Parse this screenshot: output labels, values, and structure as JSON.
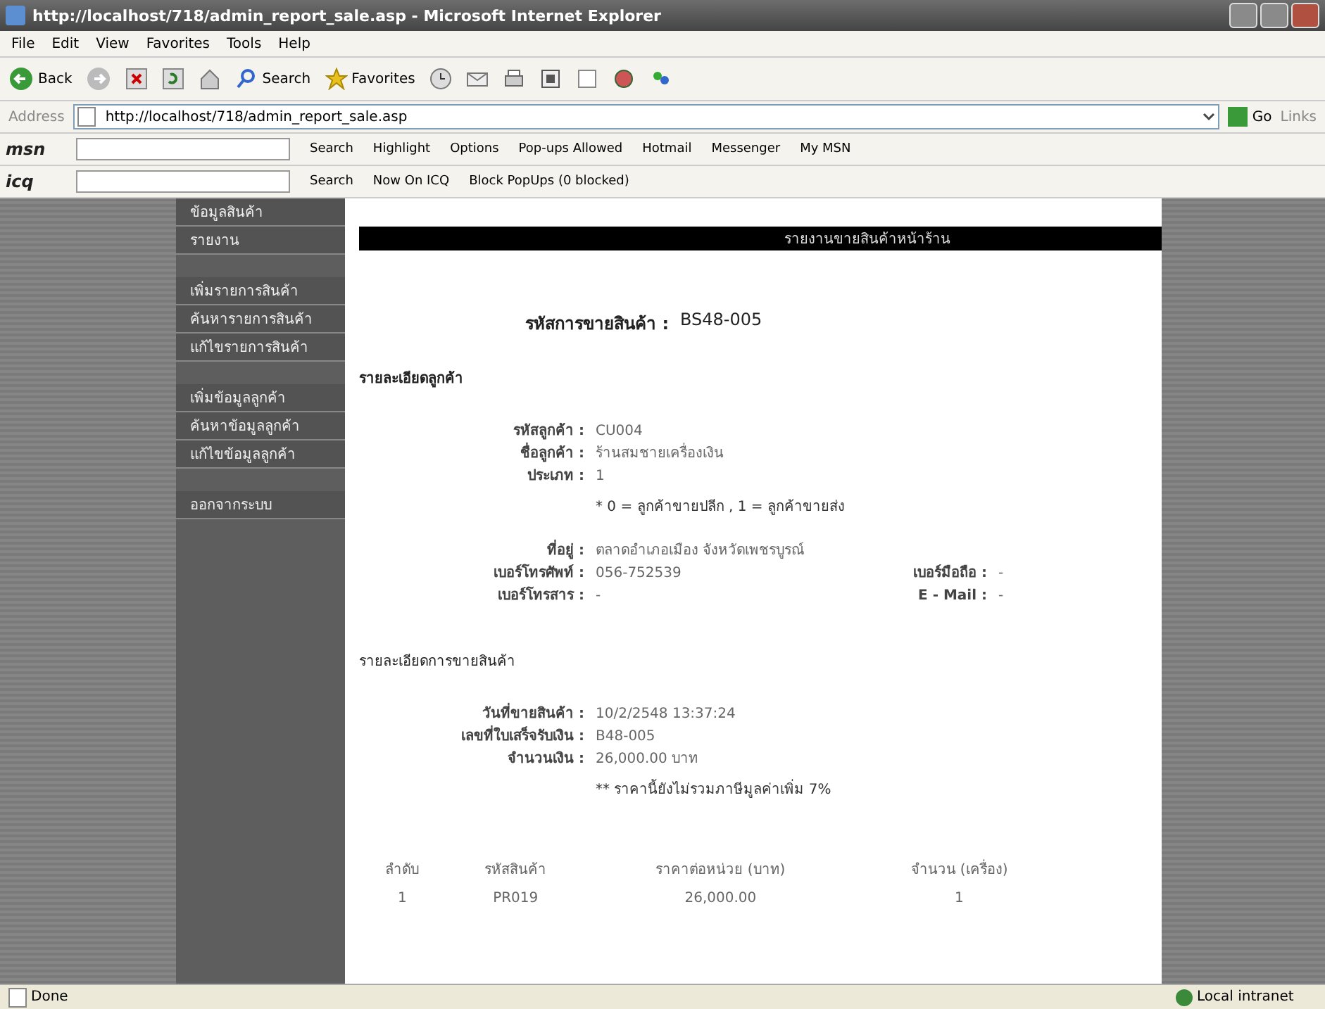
{
  "window": {
    "title": "http://localhost/718/admin_report_sale.asp - Microsoft Internet Explorer"
  },
  "menu": [
    "File",
    "Edit",
    "View",
    "Favorites",
    "Tools",
    "Help"
  ],
  "toolbar": {
    "back": "Back",
    "search": "Search",
    "favorites": "Favorites"
  },
  "address_bar": {
    "label": "Address",
    "value": "http://localhost/718/admin_report_sale.asp",
    "go": "Go",
    "links": "Links"
  },
  "msn_bar": {
    "logo": "msn",
    "items": [
      "Search",
      "Highlight",
      "Options",
      "Pop-ups Allowed",
      "Hotmail",
      "Messenger",
      "My MSN"
    ]
  },
  "icq_bar": {
    "logo": "icq",
    "items": [
      "Search",
      "Now On ICQ",
      "Block PopUps (0 blocked)"
    ]
  },
  "sidebar": {
    "groups": [
      [
        "ข้อมูลสินค้า",
        "รายงาน"
      ],
      [
        "เพิ่มรายการสินค้า",
        "ค้นหารายการสินค้า",
        "แก้ไขรายการสินค้า"
      ],
      [
        "เพิ่มข้อมูลลูกค้า",
        "ค้นหาข้อมูลลูกค้า",
        "แก้ไขข้อมูลลูกค้า"
      ],
      [
        "ออกจากระบบ"
      ]
    ]
  },
  "report": {
    "header": "รายงานขายสินค้าหน้าร้าน",
    "sale_code": {
      "label": "รหัสการขายสินค้า :",
      "value": "BS48-005"
    },
    "customer_title": "รายละเอียดลูกค้า",
    "customer_fields": [
      {
        "label": "รหัสลูกค้า :",
        "value": "CU004"
      },
      {
        "label": "ชื่อลูกค้า :",
        "value": "ร้านสมชายเครื่องเงิน"
      },
      {
        "label": "ประเภท :",
        "value": "1"
      }
    ],
    "type_note": "* 0 = ลูกค้าขายปลีก , 1 = ลูกค้าขายส่ง",
    "address": {
      "label": "ที่อยู่ :",
      "value": "ตลาดอำเภอเมือง จังหวัดเพชรบูรณ์"
    },
    "contact_rows": [
      [
        {
          "label": "เบอร์โทรศัพท์ :",
          "value": "056-752539"
        },
        {
          "label": "เบอร์มือถือ :",
          "value": "-"
        }
      ],
      [
        {
          "label": "เบอร์โทรสาร :",
          "value": "-"
        },
        {
          "label": "E - Mail :",
          "value": "-"
        }
      ]
    ],
    "sale_title": "รายละเอียดการขายสินค้า",
    "sale_fields": [
      {
        "label": "วันที่ขายสินค้า :",
        "value": "10/2/2548 13:37:24"
      },
      {
        "label": "เลขที่ใบเสร็จรับเงิน :",
        "value": "B48-005"
      },
      {
        "label": "จำนวนเงิน :",
        "value": "26,000.00 บาท"
      }
    ],
    "vat_note": "** ราคานี้ยังไม่รวมภาษีมูลค่าเพิ่ม 7%",
    "table": {
      "columns": [
        "ลำดับ",
        "รหัสสินค้า",
        "ราคาต่อหน่วย (บาท)",
        "จำนวน (เครื่อง)"
      ],
      "rows": [
        [
          "1",
          "PR019",
          "26,000.00",
          "1"
        ]
      ]
    }
  },
  "status_bar": {
    "text": "Done",
    "zone": "Local intranet"
  }
}
